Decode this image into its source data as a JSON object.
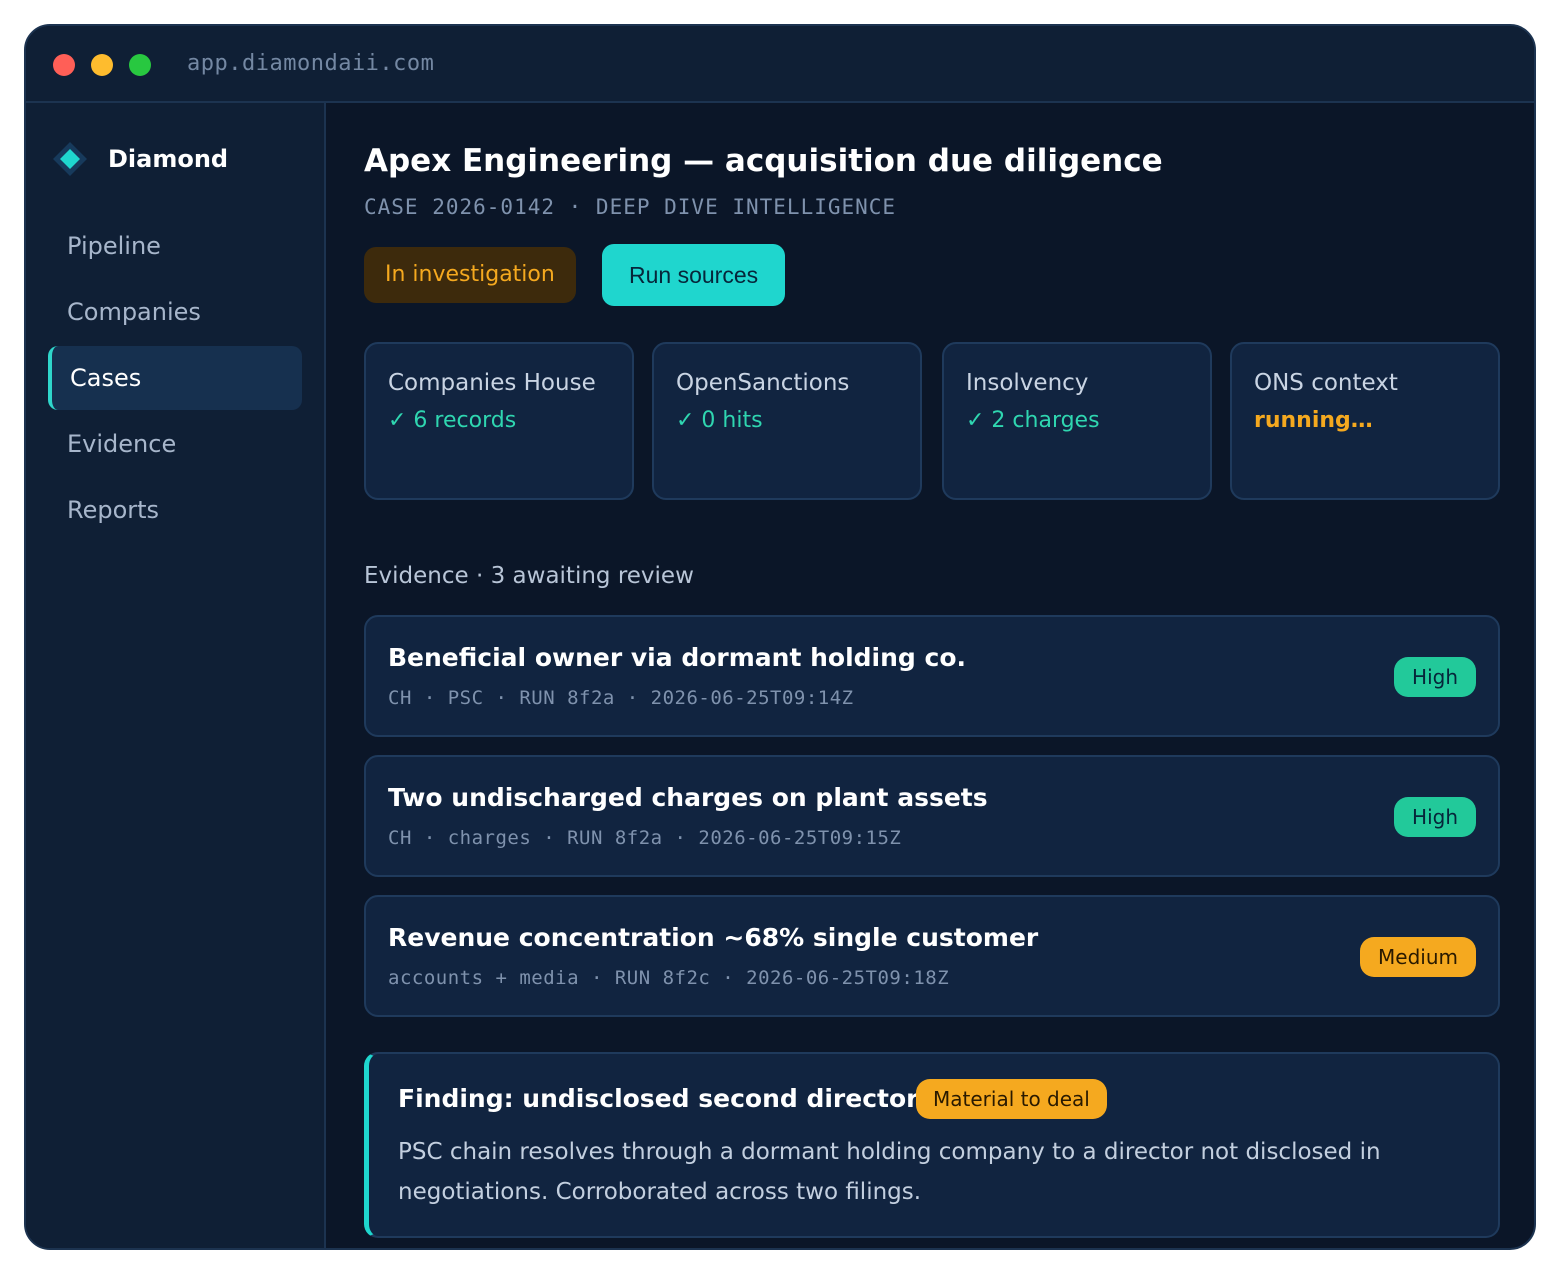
{
  "window": {
    "url": "app.diamondaii.com"
  },
  "sidebar": {
    "brand": "Diamond",
    "items": [
      {
        "label": "Pipeline",
        "active": false
      },
      {
        "label": "Companies",
        "active": false
      },
      {
        "label": "Cases",
        "active": true
      },
      {
        "label": "Evidence",
        "active": false
      },
      {
        "label": "Reports",
        "active": false
      }
    ]
  },
  "case": {
    "title": "Apex Engineering — acquisition due diligence",
    "meta": "CASE 2026-0142 · DEEP DIVE INTELLIGENCE",
    "status": "In investigation",
    "run_label": "Run sources"
  },
  "sources": [
    {
      "name": "Companies House",
      "status": "✓ 6 records",
      "state": "ok"
    },
    {
      "name": "OpenSanctions",
      "status": "✓ 0 hits",
      "state": "ok"
    },
    {
      "name": "Insolvency",
      "status": "✓ 2 charges",
      "state": "ok"
    },
    {
      "name": "ONS context",
      "status": "running…",
      "state": "running"
    }
  ],
  "evidence": {
    "heading": "Evidence · 3 awaiting review",
    "items": [
      {
        "title": "Beneficial owner via dormant holding co.",
        "meta": "CH · PSC · RUN 8f2a · 2026-06-25T09:14Z",
        "severity": "High"
      },
      {
        "title": "Two undischarged charges on plant assets",
        "meta": "CH · charges · RUN 8f2a · 2026-06-25T09:15Z",
        "severity": "High"
      },
      {
        "title": "Revenue concentration ~68% single customer",
        "meta": "accounts + media · RUN 8f2c · 2026-06-25T09:18Z",
        "severity": "Medium"
      }
    ]
  },
  "finding": {
    "title": "Finding: undisclosed second director",
    "badge": "Material to deal",
    "body": "PSC chain resolves through a dormant holding company to a director not disclosed in negotiations. Corroborated across two filings."
  },
  "colors": {
    "accent": "#1fd6ce",
    "ok": "#2fd6b0",
    "warning": "#f5a91f",
    "high": "#22c99a",
    "background": "#0b1628"
  },
  "icons": {
    "brand": "diamond-icon"
  }
}
